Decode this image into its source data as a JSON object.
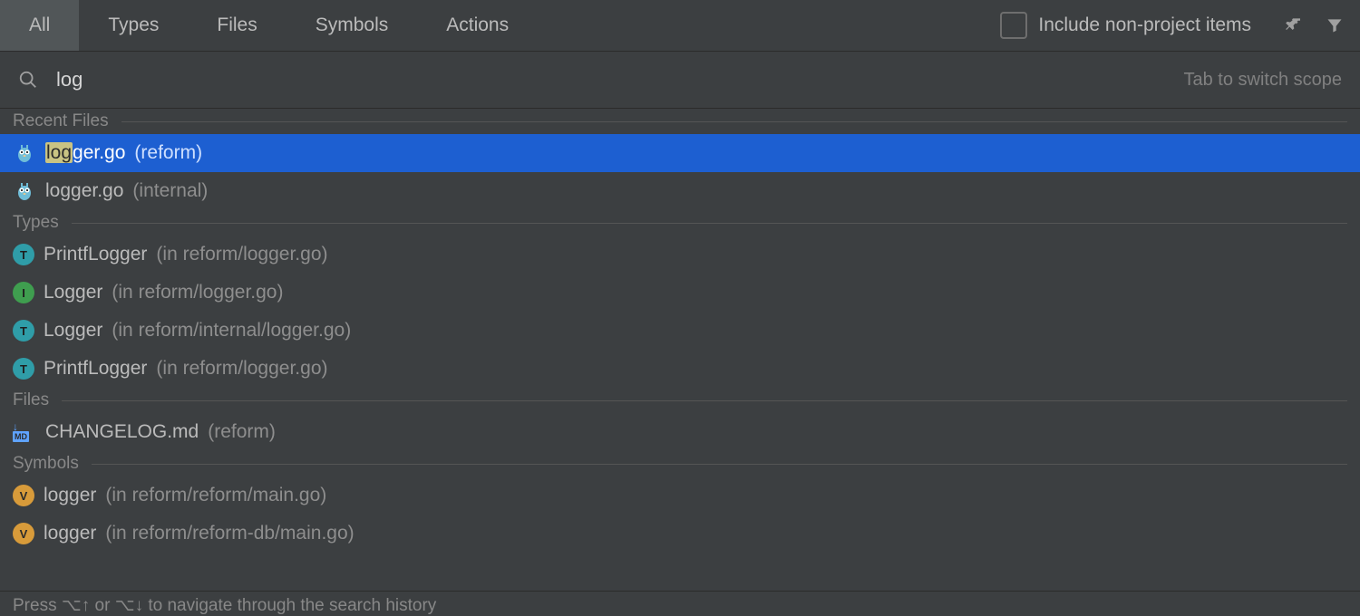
{
  "tabs": {
    "all": "All",
    "types": "Types",
    "files": "Files",
    "symbols": "Symbols",
    "actions": "Actions"
  },
  "include_checkbox": {
    "label": "Include non-project items",
    "checked": false
  },
  "search": {
    "value": "log",
    "hint": "Tab to switch scope"
  },
  "sections": {
    "recent_files": {
      "title": "Recent Files",
      "items": [
        {
          "icon": "go",
          "prefix_hl": "log",
          "rest": "ger.go",
          "loc": "(reform)",
          "selected": true
        },
        {
          "icon": "go",
          "prefix_hl": "",
          "rest": "logger.go",
          "loc": "(internal)",
          "selected": false
        }
      ]
    },
    "types": {
      "title": "Types",
      "items": [
        {
          "kind": "t",
          "name": "PrintfLogger",
          "loc": "(in reform/logger.go)"
        },
        {
          "kind": "i",
          "name": "Logger",
          "loc": "(in reform/logger.go)"
        },
        {
          "kind": "t",
          "name": "Logger",
          "loc": "(in reform/internal/logger.go)"
        },
        {
          "kind": "t",
          "name": "PrintfLogger",
          "loc": "(in reform/logger.go)"
        }
      ]
    },
    "files": {
      "title": "Files",
      "items": [
        {
          "icon": "md",
          "name": "CHANGELOG.md",
          "loc": "(reform)"
        }
      ]
    },
    "symbols": {
      "title": "Symbols",
      "items": [
        {
          "kind": "v",
          "name": "logger",
          "loc": "(in reform/reform/main.go)"
        },
        {
          "kind": "v",
          "name": "logger",
          "loc": "(in reform/reform-db/main.go)"
        }
      ]
    }
  },
  "footer": "Press ⌥↑ or ⌥↓ to navigate through the search history"
}
